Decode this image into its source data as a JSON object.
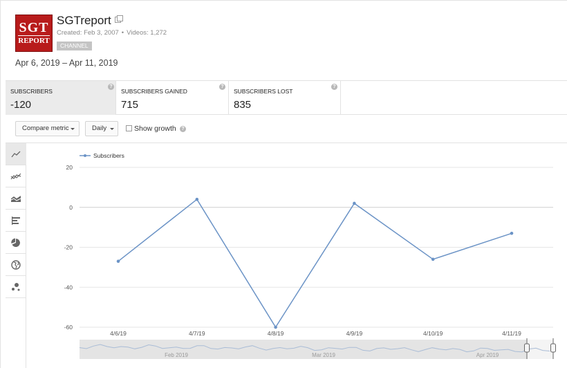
{
  "channel": {
    "logo_text_top": "SGT",
    "logo_text_bottom": "REPORT",
    "name": "SGTreport",
    "created": "Created: Feb 3, 2007",
    "videos": "Videos: 1,272",
    "badge": "CHANNEL"
  },
  "date_range": "Apr 6, 2019 – Apr 11, 2019",
  "metrics": [
    {
      "label": "SUBSCRIBERS",
      "value": "-120",
      "active": true
    },
    {
      "label": "SUBSCRIBERS GAINED",
      "value": "715",
      "active": false
    },
    {
      "label": "SUBSCRIBERS LOST",
      "value": "835",
      "active": false
    }
  ],
  "controls": {
    "compare_label": "Compare metric",
    "interval_label": "Daily",
    "show_growth_label": "Show growth",
    "show_growth_checked": false
  },
  "toolbar": [
    {
      "icon": "line-chart-icon",
      "active": true
    },
    {
      "icon": "multi-line-chart-icon",
      "active": false
    },
    {
      "icon": "stacked-area-chart-icon",
      "active": false
    },
    {
      "icon": "bar-chart-icon",
      "active": false
    },
    {
      "icon": "pie-chart-icon",
      "active": false
    },
    {
      "icon": "globe-map-icon",
      "active": false
    },
    {
      "icon": "bubble-chart-icon",
      "active": false
    }
  ],
  "colors": {
    "series": "#6b93c6",
    "active_tab": "#ebebeb",
    "grid": "#e6e6e6"
  },
  "chart_data": {
    "type": "line",
    "x": [
      "4/6/19",
      "4/7/19",
      "4/8/19",
      "4/9/19",
      "4/10/19",
      "4/11/19"
    ],
    "series": [
      {
        "name": "Subscribers",
        "values": [
          -27,
          4,
          -60,
          2,
          -26,
          -13
        ]
      }
    ],
    "yticks": [
      20,
      0,
      -20,
      -40,
      -60
    ],
    "ylim": [
      -60,
      20
    ],
    "legend": "top-left",
    "grid": true,
    "navigator_labels": [
      "Feb 2019",
      "Mar 2019",
      "Apr 2019"
    ]
  }
}
